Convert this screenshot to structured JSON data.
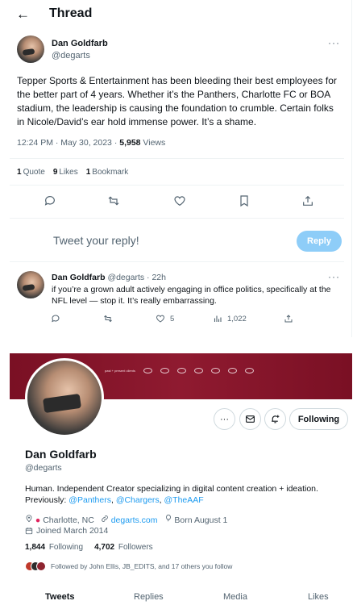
{
  "thread": {
    "title": "Thread",
    "tweet": {
      "author_name": "Dan Goldfarb",
      "author_handle": "@degarts",
      "text": "Tepper Sports & Entertainment has been bleeding their best employees for the better part of 4 years. Whether it’s the Panthers, Charlotte FC or BOA stadium, the leadership is causing the foundation to crumble. Certain folks in Nicole/David’s ear hold immense power. It’s a shame.",
      "time": "12:24 PM · May 30, 2023 · ",
      "views_count": "5,958",
      "views_label": " Views",
      "quotes_count": "1",
      "quotes_label": "Quote",
      "likes_count": "9",
      "likes_label": "Likes",
      "bookmarks_count": "1",
      "bookmarks_label": "Bookmark"
    },
    "reply_box": {
      "placeholder": "Tweet your reply!",
      "button_label": "Reply"
    },
    "reply": {
      "author_name": "Dan Goldfarb",
      "meta": "@degarts · 22h",
      "text": "if you’re a grown adult actively engaging in office politics, specifically at the NFL level — stop it. It’s really embarrassing.",
      "likes": "5",
      "views": "1,022"
    }
  },
  "profile": {
    "banner_tagline": "past + present clients",
    "name": "Dan Goldfarb",
    "handle": "@degarts",
    "bio_text": "Human. Independent Creator specializing in digital content creation + ideation. Previously: ",
    "bio_links": [
      "@Panthers",
      "@Chargers",
      "@TheAAF"
    ],
    "bio_sep": ", ",
    "location": "Charlotte, NC",
    "website": "degarts.com",
    "born": "Born August 1",
    "joined": "Joined March 2014",
    "following_count": "1,844",
    "following_label": "Following",
    "followers_count": "4,702",
    "followers_label": "Followers",
    "followed_by": "Followed by John Ellis, JB_EDITS, and 17 others you follow",
    "follow_button": "Following",
    "tabs": [
      "Tweets",
      "Replies",
      "Media",
      "Likes"
    ]
  },
  "colors": {
    "accent": "#1d9bf0",
    "reply_button": "#8ecdf8",
    "banner": "#7a1024"
  }
}
